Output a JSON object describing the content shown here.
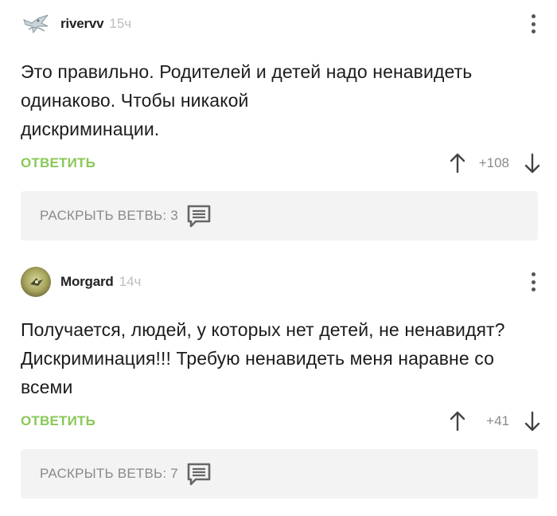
{
  "comments": [
    {
      "username": "rivervv",
      "time": "15ч",
      "text_lines": [
        "Это правильно. Родителей и детей надо ненавидеть",
        "одинаково. Чтобы никакой",
        "дискриминации."
      ],
      "reply_label": "ОТВЕТИТЬ",
      "score": "+108",
      "branch_label": "РАСКРЫТЬ ВЕТВЬ: 3"
    },
    {
      "username": "Morgard",
      "time": "14ч",
      "text_lines": [
        "Получается, людей, у которых нет детей, не ненавидят?",
        "Дискриминация!!! Требую ненавидеть меня наравне со",
        "всеми"
      ],
      "reply_label": "ОТВЕТИТЬ",
      "score": "+41",
      "branch_label": "РАСКРЫТЬ ВЕТВЬ: 7"
    }
  ],
  "colors": {
    "reply": "#8ac858",
    "muted": "#8a8a8a",
    "branch_bg": "#f3f3f3"
  },
  "icons": {
    "more": "vertical-dots-icon",
    "upvote": "arrow-up-icon",
    "downvote": "arrow-down-icon",
    "branch": "comment-icon"
  }
}
